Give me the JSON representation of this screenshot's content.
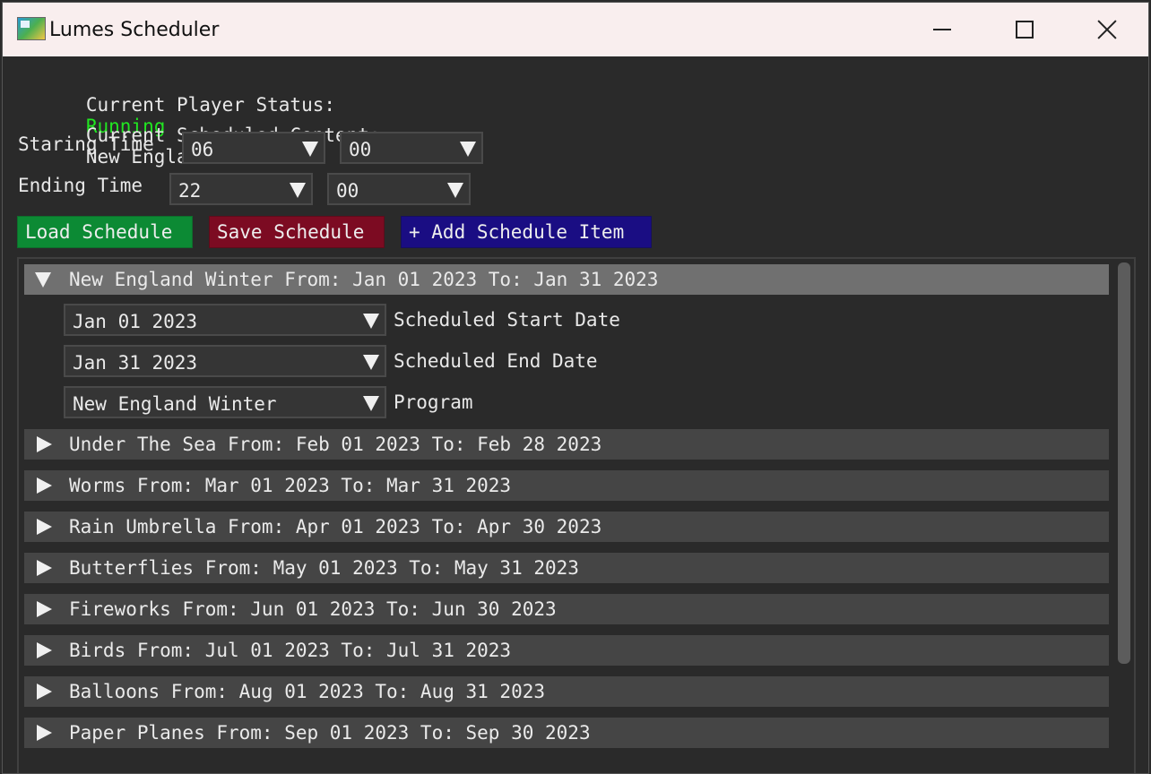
{
  "window": {
    "title": "Lumes Scheduler"
  },
  "status": {
    "label": "Current Player Status:",
    "value": "Running",
    "value_color": "#21e621"
  },
  "scheduled": {
    "label": "Current Scheduled Content:",
    "value": "New England Winter"
  },
  "starting": {
    "label": "Staring Time",
    "hour": "06",
    "minute": "00"
  },
  "ending": {
    "label": "Ending Time",
    "hour": "22",
    "minute": "00"
  },
  "buttons": {
    "load": "Load Schedule",
    "save": "Save Schedule",
    "add": "+ Add Schedule Item",
    "load_color": "#0c8a34",
    "save_color": "#7c0b22",
    "add_color": "#1a0d83"
  },
  "schedule": {
    "items": [
      {
        "label": "New England Winter From: Jan 01 2023 To: Jan 31 2023",
        "expanded": true
      },
      {
        "label": "Under The Sea From: Feb 01 2023 To: Feb 28 2023",
        "expanded": false
      },
      {
        "label": "Worms From: Mar 01 2023 To: Mar 31 2023",
        "expanded": false
      },
      {
        "label": "Rain Umbrella From: Apr 01 2023 To: Apr 30 2023",
        "expanded": false
      },
      {
        "label": "Butterflies From: May 01 2023 To: May 31 2023",
        "expanded": false
      },
      {
        "label": "Fireworks From: Jun 01 2023 To: Jun 30 2023",
        "expanded": false
      },
      {
        "label": "Birds From: Jul 01 2023 To: Jul 31 2023",
        "expanded": false
      },
      {
        "label": "Balloons From: Aug 01 2023 To: Aug 31 2023",
        "expanded": false
      },
      {
        "label": "Paper Planes From: Sep 01 2023 To: Sep 30 2023",
        "expanded": false
      }
    ],
    "detail": {
      "start_date": "Jan 01 2023",
      "start_label": "Scheduled Start Date",
      "end_date": "Jan 31 2023",
      "end_label": "Scheduled End Date",
      "program": "New England Winter",
      "program_label": "Program"
    }
  }
}
